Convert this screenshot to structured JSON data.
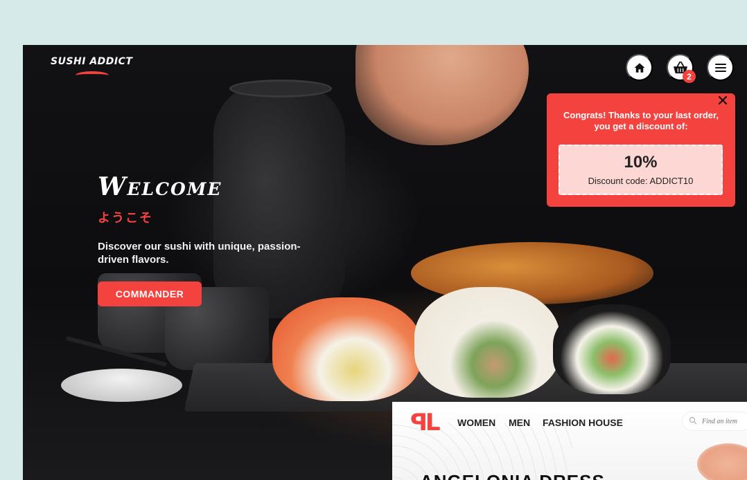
{
  "sushi_site": {
    "logo": "SUSHI ADDICT",
    "nav": {
      "home_icon": "home-icon",
      "cart_icon": "basket-icon",
      "cart_count": "2",
      "menu_icon": "hamburger-icon"
    },
    "hero": {
      "title": "Welcome",
      "title_jp": "ようこそ",
      "tagline": "Discover our sushi with unique, passion-driven flavors.",
      "cta_label": "COMMANDER"
    },
    "popup": {
      "message": "Congrats! Thanks to your last order, you get a discount of:",
      "discount": "10%",
      "code_text": "Discount code: ADDICT10",
      "close_icon": "close-icon"
    },
    "colors": {
      "accent": "#f4423f",
      "coupon_bg": "#fdd7d3",
      "site_bg": "#121214",
      "page_bg": "#d6ebe9"
    }
  },
  "fashion_site": {
    "logo": "ꟼL",
    "nav": [
      "WOMEN",
      "MEN",
      "FASHION HOUSE"
    ],
    "search_placeholder": "Find an item",
    "title": "ANGELONIA DRESS"
  }
}
